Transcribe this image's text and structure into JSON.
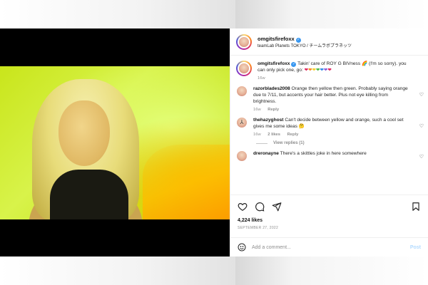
{
  "post": {
    "username": "omgitsfirefoxx",
    "location": "teamLab Planets TOKYO / チームラボプラネッツ",
    "caption": {
      "username": "omgitsfirefoxx",
      "text": "Takin' care of ROY G BIVness 🌈 (I'm so sorry). you can only pick one, go:",
      "hearts": [
        {
          "emoji": "❤",
          "color": "#e0245e"
        },
        {
          "emoji": "❤",
          "color": "#f58d20"
        },
        {
          "emoji": "❤",
          "color": "#f5cf2a"
        },
        {
          "emoji": "❤",
          "color": "#4cb849"
        },
        {
          "emoji": "❤",
          "color": "#2e8ae6"
        },
        {
          "emoji": "❤",
          "color": "#8a5bd6"
        },
        {
          "emoji": "❤",
          "color": "#e0245e"
        }
      ],
      "time": "16w"
    },
    "comments": [
      {
        "username": "razorblades2008",
        "text": "Orange then yellow then green. Probably saying orange due to 7/11, but accents your hair better. Plus not eye killing from brightness.",
        "time": "16w",
        "reply_label": "Reply"
      },
      {
        "username": "thehazyghost",
        "text": "Can't decide between yellow and orange, such a cool set gives me some ideas 🤔",
        "time": "16w",
        "likes": "2 likes",
        "reply_label": "Reply",
        "view_replies": "View replies (1)"
      },
      {
        "username": "dreronayne",
        "text": "There's a skittles joke in here somewhere"
      }
    ],
    "likes": "4,224 likes",
    "date": "SEPTEMBER 27, 2022",
    "add_comment_placeholder": "Add a comment...",
    "post_button": "Post"
  },
  "colors": {
    "verified": "#3897f0",
    "post_button": "#b3dbff"
  },
  "icons": {
    "like": "heart-icon",
    "comment": "comment-icon",
    "share": "share-icon",
    "save": "bookmark-icon",
    "emoji": "smile-icon"
  }
}
